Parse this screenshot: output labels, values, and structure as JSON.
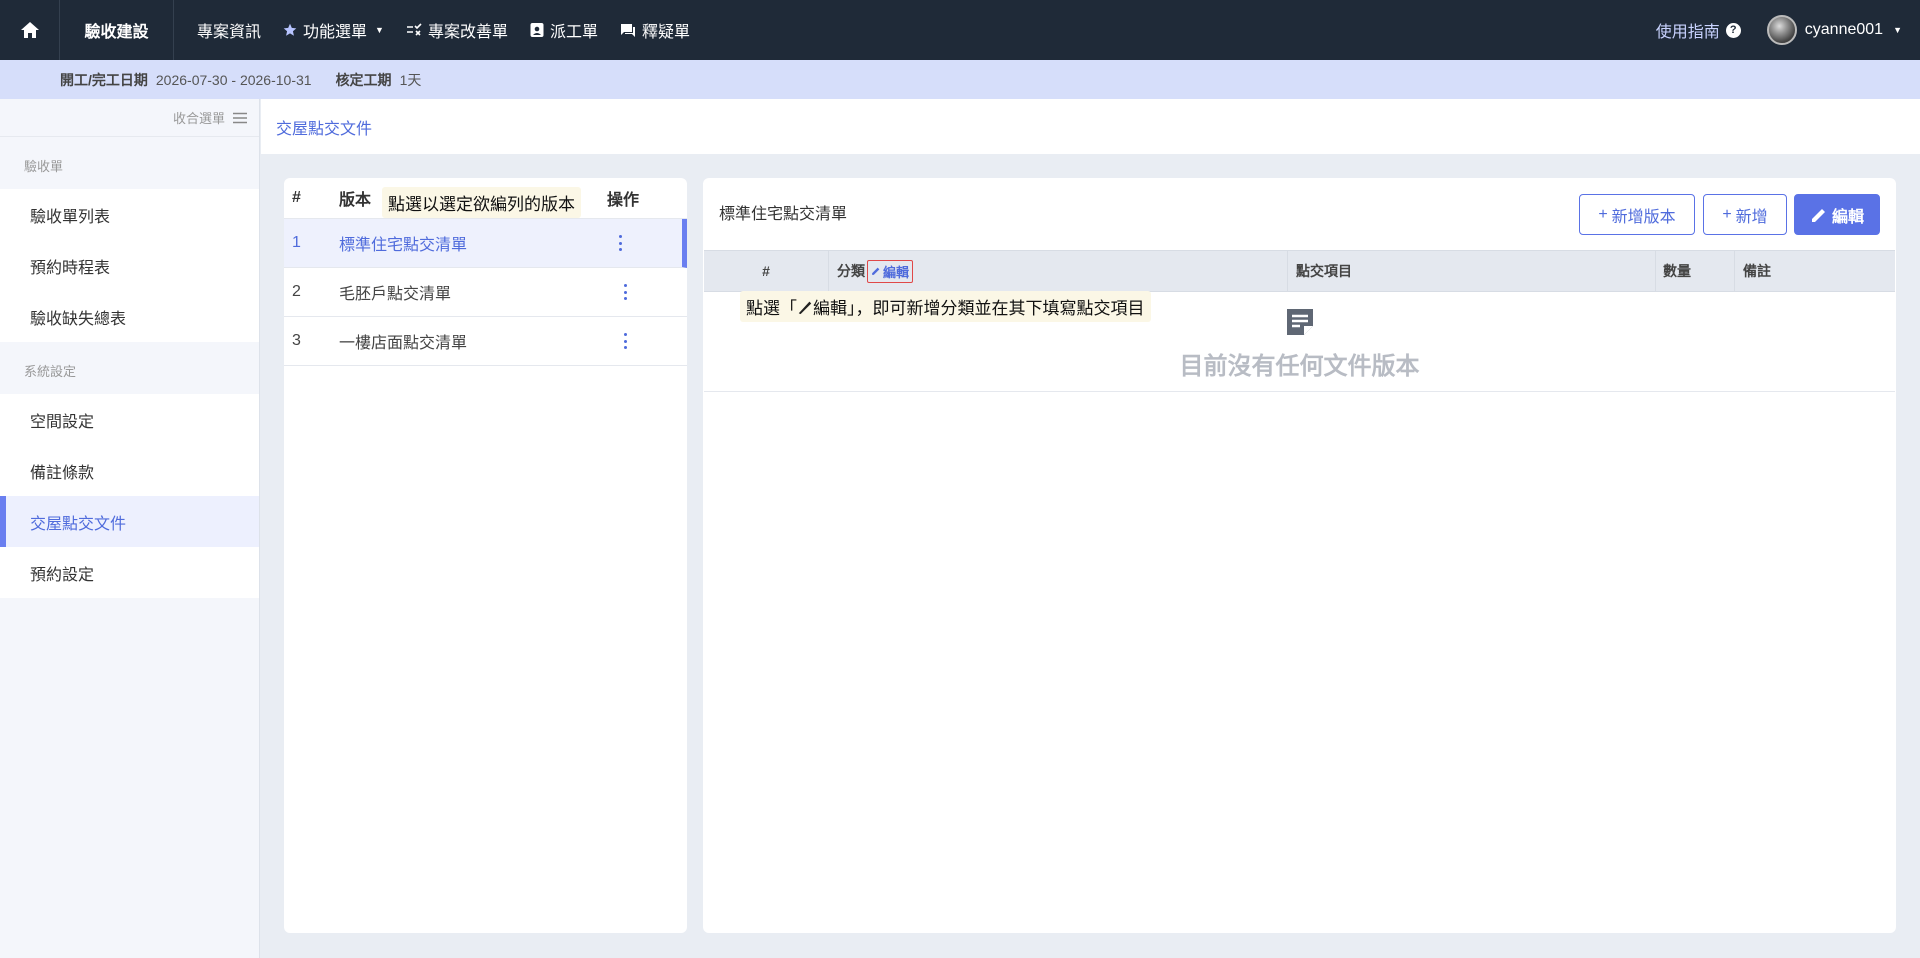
{
  "nav": {
    "brand": "驗收建設",
    "items": [
      {
        "label": "專案資訊",
        "icon": "none"
      },
      {
        "label": "功能選單",
        "icon": "star-icon"
      },
      {
        "label": "專案改善單",
        "icon": "checklist-icon"
      },
      {
        "label": "派工單",
        "icon": "badge-icon"
      },
      {
        "label": "釋疑單",
        "icon": "chat-icon"
      }
    ],
    "guide": "使用指南",
    "username": "cyanne001"
  },
  "info": {
    "date_label": "開工/完工日期",
    "date_value": "2026-07-30 - 2026-10-31",
    "duration_label": "核定工期",
    "duration_value": "1天"
  },
  "sidebar": {
    "collapse_label": "收合選單",
    "sections": [
      {
        "title": "驗收單",
        "items": [
          "驗收單列表",
          "預約時程表",
          "驗收缺失總表"
        ]
      },
      {
        "title": "系統設定",
        "items": [
          "空間設定",
          "備註條款",
          "交屋點交文件",
          "預約設定"
        ]
      }
    ],
    "active_item": "交屋點交文件"
  },
  "page": {
    "title": "交屋點交文件"
  },
  "versions": {
    "headers": {
      "num": "#",
      "name": "版本",
      "op": "操作"
    },
    "rows": [
      {
        "num": "1",
        "name": "標準住宅點交清單"
      },
      {
        "num": "2",
        "name": "毛胚戶點交清單"
      },
      {
        "num": "3",
        "name": "一樓店面點交清單"
      }
    ],
    "tooltip": "點選以選定欲編列的版本"
  },
  "detail": {
    "title": "標準住宅點交清單",
    "buttons": {
      "add_version": "新增版本",
      "add": "新增",
      "edit": "編輯"
    },
    "headers": {
      "num": "#",
      "category": "分類",
      "category_edit": "編輯",
      "item": "點交項目",
      "qty": "數量",
      "note": "備註"
    },
    "empty_text": "目前沒有任何文件版本",
    "tooltip_prefix": "點選「",
    "tooltip_suffix": "編輯」，即可新增分類並在其下填寫點交項目"
  },
  "colors": {
    "nav_bg": "#1f2a38",
    "accent": "#5a72e6",
    "info_bg": "#d6defa"
  }
}
